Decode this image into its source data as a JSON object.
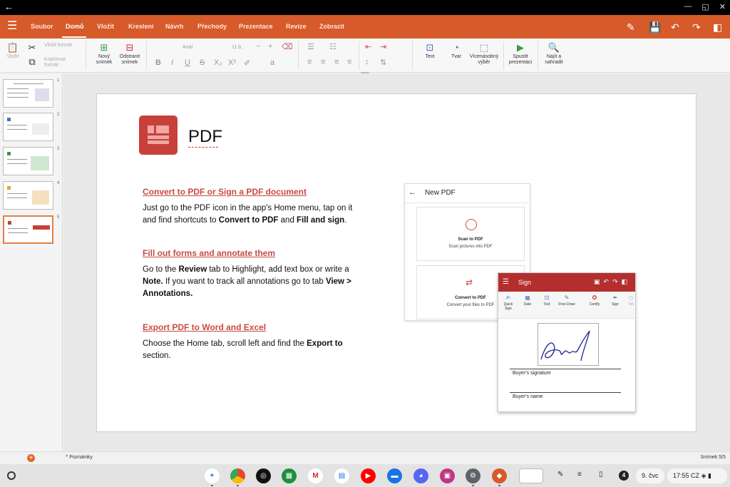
{
  "ribbon": {
    "tabs": [
      "Soubor",
      "Domů",
      "Vložit",
      "Kreslení",
      "Návrh",
      "Přechody",
      "Prezentace",
      "Revize",
      "Zobrazit"
    ],
    "active_tab": "Domů"
  },
  "toolbar": {
    "paste": "Vložit",
    "paste_format": "Vložit formát",
    "copy_format": "Kopírovat formát",
    "new_slide": "Nový snímek",
    "delete_slide": "Odstranit snímek",
    "font_name": "Arial",
    "font_size": "11 b.",
    "text": "Text",
    "shape": "Tvar",
    "multi_select": "Vícenásobný výběr",
    "start_presentation": "Spustit prezentaci",
    "find_replace": "Najít a nahradit"
  },
  "slides_panel": {
    "numbers": [
      "1",
      "2",
      "3",
      "4",
      "5"
    ],
    "active_index": 5
  },
  "slide": {
    "title": "PDF",
    "sections": [
      {
        "heading": "Convert to PDF or Sign a PDF document",
        "body_1": "Just go to the PDF icon in the app's Home menu, tap on it and find shortcuts to ",
        "bold_1": "Convert to PDF",
        "body_2": " and ",
        "bold_2": "Fill and sign",
        "body_3": "."
      },
      {
        "heading": "Fill out forms and annotate them",
        "body_1": "Go to the ",
        "bold_1": "Review",
        "body_2": " tab to Highlight, add text box or write a ",
        "bold_2": "Note.",
        "body_3": " If you want to track all annotations go to tab ",
        "bold_3": "View > Annotations."
      },
      {
        "heading": "Export PDF to Word and Excel",
        "body_1": "Choose the Home tab, scroll left and find the ",
        "bold_1": "Export to",
        "body_2": " section."
      }
    ],
    "new_pdf_card": {
      "title": "New PDF",
      "scan_title": "Scan to PDF",
      "scan_desc": "Scan pictures into PDF",
      "convert_title": "Convert to PDF",
      "convert_desc": "Convert your files to PDF"
    },
    "sign_card": {
      "title": "Sign",
      "tools": [
        "Quick Sign",
        "Date",
        "Text",
        "Free Draw",
        "Certify",
        "Sign",
        "Tim"
      ],
      "buyer_signature": "Buyer's signature",
      "buyer_name": "Buyer's name"
    }
  },
  "status": {
    "notes": "Poznámky",
    "slide_count": "Snímek 5/5"
  },
  "taskbar": {
    "date": "9. čvc",
    "time": "17:55",
    "locale": "CZ",
    "notification_count": "4"
  },
  "colors": {
    "accent": "#d65a2a",
    "heading_red": "#c94a43",
    "sign_bar": "#b52e2e"
  }
}
